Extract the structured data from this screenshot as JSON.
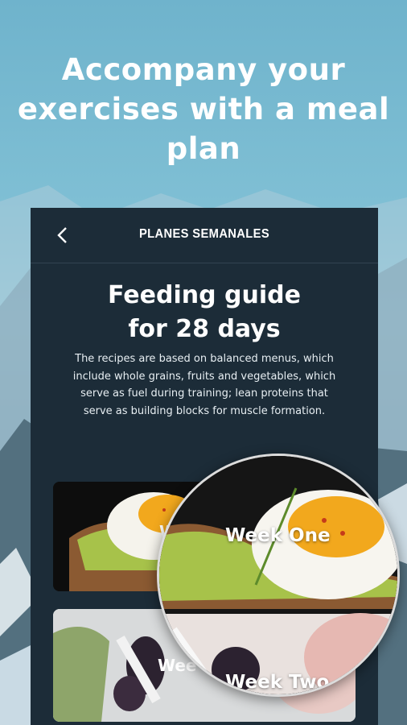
{
  "promo": {
    "line1": "Accompany your",
    "line2": "exercises with a meal",
    "line3": "plan"
  },
  "app": {
    "header_title": "PLANES SEMANALES",
    "back_icon": "chevron-left-icon",
    "hero_title_line1": "Feeding guide",
    "hero_title_line2": "for 28 days",
    "description": "The recipes are based on balanced menus, which include whole grains, fruits and vegetables, which serve as fuel during training; lean proteins that serve as building blocks for muscle formation."
  },
  "weeks": [
    {
      "label": "Week One",
      "partial_label": "W"
    },
    {
      "label": "Week Two",
      "partial_label": "Wee"
    }
  ],
  "colors": {
    "panel": "#1c2c38",
    "egg_yolk": "#f2a81d",
    "avocado": "#a7c24a"
  }
}
